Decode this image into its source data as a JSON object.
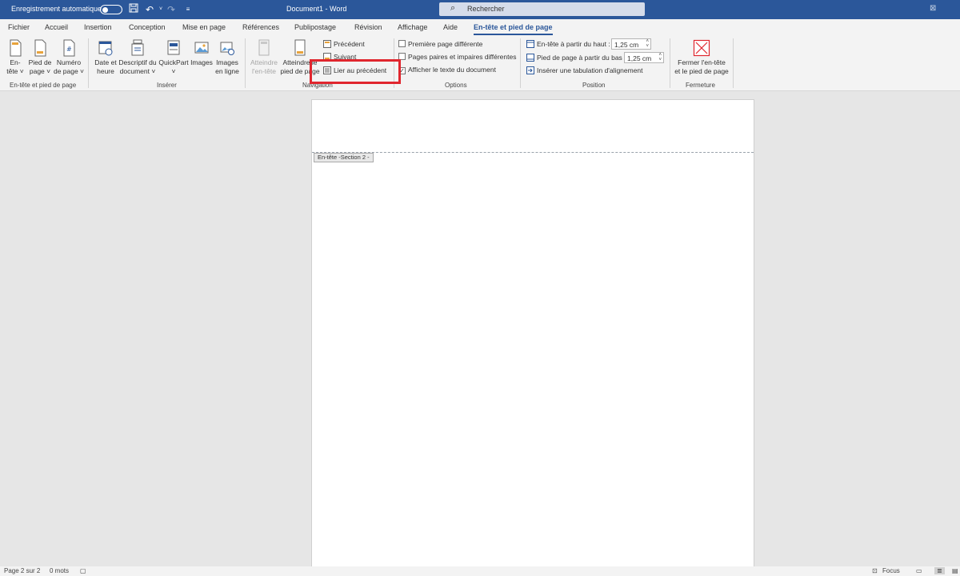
{
  "titlebar": {
    "autosave_label": "Enregistrement automatique",
    "document_title": "Document1  -  Word",
    "search_placeholder": "Rechercher"
  },
  "menu": {
    "tabs": [
      "Fichier",
      "Accueil",
      "Insertion",
      "Conception",
      "Mise en page",
      "Références",
      "Publipostage",
      "Révision",
      "Affichage",
      "Aide",
      "En-tête et pied de page"
    ],
    "active_tab": "En-tête et pied de page"
  },
  "ribbon": {
    "group_header_footer": {
      "label": "En-tête et pied de page",
      "entete": [
        "En-",
        "tête ˅"
      ],
      "pied": [
        "Pied de",
        "page ˅"
      ],
      "numero": [
        "Numéro",
        "de page ˅"
      ]
    },
    "group_inserer": {
      "label": "Insérer",
      "date": [
        "Date et",
        "heure"
      ],
      "descriptif": [
        "Descriptif du",
        "document ˅"
      ],
      "quickpart": [
        "QuickPart",
        "˅"
      ],
      "images": "Images",
      "images_ligne": [
        "Images",
        "en ligne"
      ]
    },
    "group_navigation": {
      "label": "Navigation",
      "atteindre_entete": [
        "Atteindre",
        "l'en-tête"
      ],
      "atteindre_pied": [
        "Atteindre le",
        "pied de page"
      ],
      "precedent": "Précédent",
      "suivant": "Suivant",
      "lier": "Lier au précédent"
    },
    "group_options": {
      "label": "Options",
      "premiere_page": "Première page différente",
      "pages_paires": "Pages paires et impaires différentes",
      "afficher_texte": "Afficher le texte du document"
    },
    "group_position": {
      "label": "Position",
      "entete_haut": "En-tête à partir du haut :",
      "entete_haut_value": "1,25 cm",
      "pied_bas": "Pied de page à partir du bas :",
      "pied_bas_value": "1,25 cm",
      "inserer_tab": "Insérer une tabulation d'alignement"
    },
    "group_fermeture": {
      "label": "Fermeture",
      "fermer": [
        "Fermer l'en-tête",
        "et le pied de page"
      ]
    }
  },
  "document": {
    "header_tag": "En-tête -Section 2 -"
  },
  "statusbar": {
    "page": "Page 2 sur 2",
    "words": "0 mots",
    "focus": "Focus"
  },
  "colors": {
    "brand": "#2b579a",
    "highlight": "#e0262e"
  }
}
